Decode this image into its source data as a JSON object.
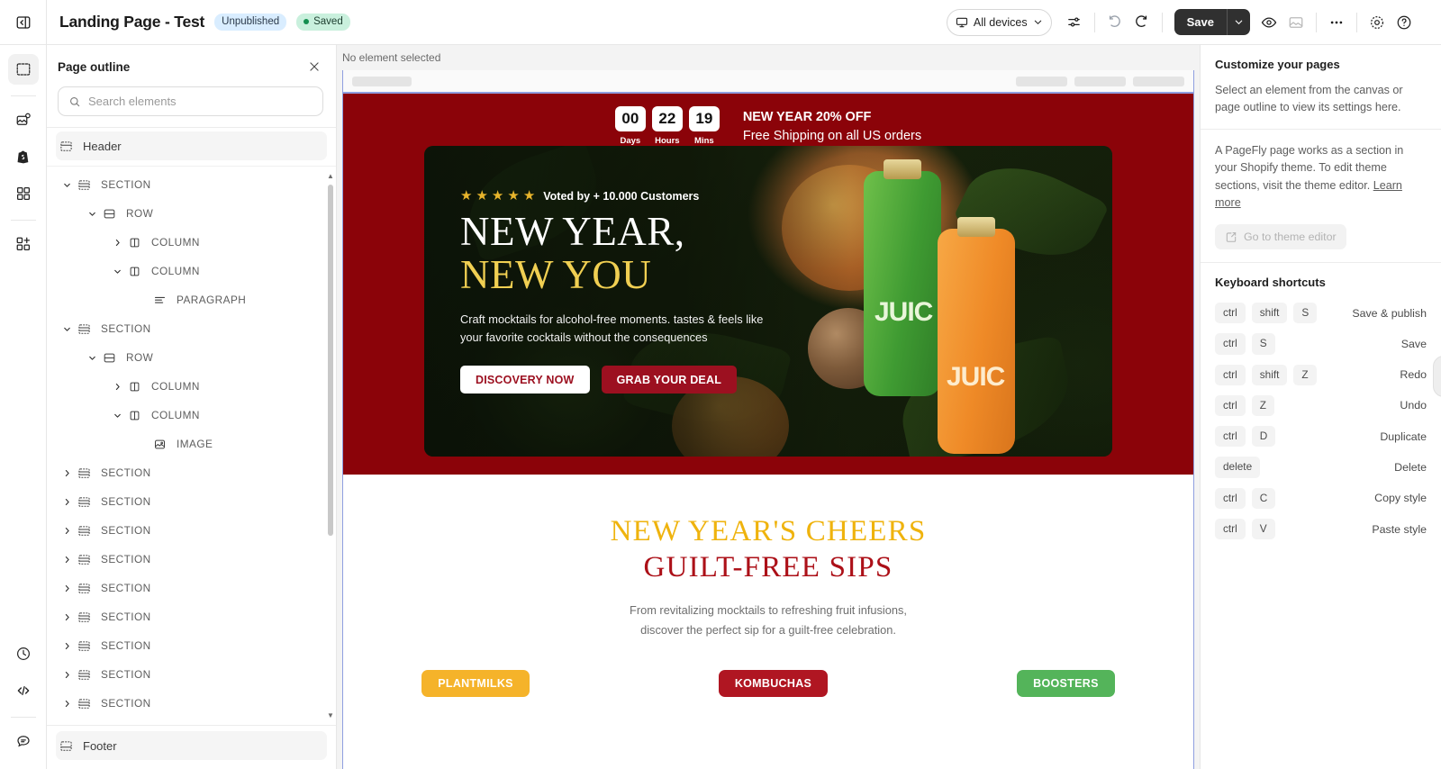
{
  "topbar": {
    "collapse_icon": "collapse-panel-icon",
    "title": "Landing Page - Test",
    "status_unpublished": "Unpublished",
    "status_saved": "Saved",
    "device_selector": "All devices",
    "save_label": "Save",
    "icons": [
      "monitor-icon",
      "chevron-down-icon",
      "sliders-icon",
      "undo-icon",
      "redo-icon",
      "eye-icon",
      "image-placeholder-icon",
      "more-horizontal-icon",
      "settings-icon",
      "help-circle-icon"
    ]
  },
  "rail": {
    "items": [
      {
        "name": "sections-icon",
        "active": true
      },
      {
        "name": "media-library-icon",
        "active": false
      },
      {
        "name": "shopify-bag-icon",
        "active": false
      },
      {
        "name": "elements-grid-icon",
        "active": false
      },
      {
        "name": "add-element-icon",
        "active": false
      }
    ],
    "bottom_items": [
      {
        "name": "history-clock-icon"
      },
      {
        "name": "code-icon"
      },
      {
        "name": "chat-support-icon"
      }
    ]
  },
  "outline": {
    "title": "Page outline",
    "close_icon": "close-icon",
    "search_placeholder": "Search elements",
    "search_value": "",
    "search_icon": "search-icon",
    "header_item": "Header",
    "footer_item": "Footer",
    "nodes": [
      {
        "label": "SECTION",
        "depth": 0,
        "caret": "down",
        "icon": "section-icon"
      },
      {
        "label": "ROW",
        "depth": 1,
        "caret": "down",
        "icon": "row-icon"
      },
      {
        "label": "COLUMN",
        "depth": 2,
        "caret": "right",
        "icon": "column-icon"
      },
      {
        "label": "COLUMN",
        "depth": 2,
        "caret": "down",
        "icon": "column-icon"
      },
      {
        "label": "PARAGRAPH",
        "depth": 3,
        "caret": "none",
        "icon": "paragraph-icon"
      },
      {
        "label": "SECTION",
        "depth": 0,
        "caret": "down",
        "icon": "section-icon"
      },
      {
        "label": "ROW",
        "depth": 1,
        "caret": "down",
        "icon": "row-icon"
      },
      {
        "label": "COLUMN",
        "depth": 2,
        "caret": "right",
        "icon": "column-icon"
      },
      {
        "label": "COLUMN",
        "depth": 2,
        "caret": "down",
        "icon": "column-icon"
      },
      {
        "label": "IMAGE",
        "depth": 3,
        "caret": "none",
        "icon": "image-icon"
      },
      {
        "label": "SECTION",
        "depth": 0,
        "caret": "right",
        "icon": "section-icon"
      },
      {
        "label": "SECTION",
        "depth": 0,
        "caret": "right",
        "icon": "section-icon"
      },
      {
        "label": "SECTION",
        "depth": 0,
        "caret": "right",
        "icon": "section-icon"
      },
      {
        "label": "SECTION",
        "depth": 0,
        "caret": "right",
        "icon": "section-icon"
      },
      {
        "label": "SECTION",
        "depth": 0,
        "caret": "right",
        "icon": "section-icon"
      },
      {
        "label": "SECTION",
        "depth": 0,
        "caret": "right",
        "icon": "section-icon"
      },
      {
        "label": "SECTION",
        "depth": 0,
        "caret": "right",
        "icon": "section-icon"
      },
      {
        "label": "SECTION",
        "depth": 0,
        "caret": "right",
        "icon": "section-icon"
      },
      {
        "label": "SECTION",
        "depth": 0,
        "caret": "right",
        "icon": "section-icon"
      }
    ]
  },
  "canvas": {
    "selection_status": "No element selected",
    "promo": {
      "countdown": [
        {
          "value": "00",
          "label": "Days"
        },
        {
          "value": "22",
          "label": "Hours"
        },
        {
          "value": "19",
          "label": "Mins"
        }
      ],
      "line1": "NEW YEAR 20% OFF",
      "line2": "Free Shipping on all US orders",
      "background": "#8b0309"
    },
    "hero": {
      "stars": "★★★★★",
      "star_count": 5,
      "voted": "Voted by + 10.000 Customers",
      "heading_line1": "NEW YEAR,",
      "heading_line2": "NEW YOU",
      "heading_accent_color": "#f0cf52",
      "paragraph": "Craft mocktails for alcohol-free moments. tastes & feels like your favorite cocktails without the consequences",
      "btn_primary": "DISCOVERY NOW",
      "btn_secondary": "GRAB YOUR DEAL",
      "bottle_text": "JUICE"
    },
    "section2": {
      "heading_line1": "NEW YEAR'S CHEERS",
      "heading_line2": "GUILT-FREE SIPS",
      "heading1_color": "#efb30d",
      "heading2_color": "#ac1018",
      "paragraph_line1": "From revitalizing mocktails to refreshing fruit infusions,",
      "paragraph_line2": "discover the perfect sip for a guilt-free celebration.",
      "chips": [
        {
          "label": "PLANTMILKS",
          "color": "#f5b32a"
        },
        {
          "label": "KOMBUCHAS",
          "color": "#b01622"
        },
        {
          "label": "BOOSTERS",
          "color": "#54b45a"
        }
      ]
    }
  },
  "right_panel": {
    "title": "Customize your pages",
    "description": "Select an element from the canvas or page outline to view its settings here.",
    "theme_note_prefix": "A PageFly page works as a section in your Shopify theme. To edit theme sections, visit the theme editor.",
    "learn_more": "Learn more",
    "theme_editor_btn": "Go to theme editor",
    "theme_editor_icon": "external-edit-icon",
    "shortcuts_title": "Keyboard shortcuts",
    "shortcuts": [
      {
        "keys": [
          "ctrl",
          "shift",
          "S"
        ],
        "action": "Save & publish"
      },
      {
        "keys": [
          "ctrl",
          "S"
        ],
        "action": "Save"
      },
      {
        "keys": [
          "ctrl",
          "shift",
          "Z"
        ],
        "action": "Redo"
      },
      {
        "keys": [
          "ctrl",
          "Z"
        ],
        "action": "Undo"
      },
      {
        "keys": [
          "ctrl",
          "D"
        ],
        "action": "Duplicate"
      },
      {
        "keys": [
          "delete"
        ],
        "action": "Delete"
      },
      {
        "keys": [
          "ctrl",
          "C"
        ],
        "action": "Copy style"
      },
      {
        "keys": [
          "ctrl",
          "V"
        ],
        "action": "Paste style"
      }
    ]
  }
}
